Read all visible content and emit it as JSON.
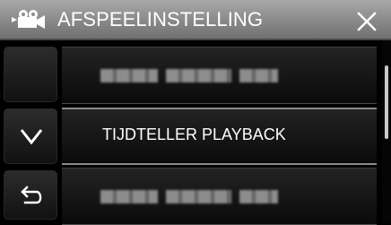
{
  "window": {
    "title": "AFSPEELINSTELLING"
  },
  "title_bar": {
    "camera_icon": "playback-camera-icon",
    "close_icon": "close-x-icon"
  },
  "navigation": {
    "down_icon": "chevron-down-icon",
    "back_icon": "return-arrow-icon"
  },
  "menu": {
    "items": [
      {
        "label": "",
        "state": "blurred-menu-option"
      },
      {
        "label": "TIJDTELLER PLAYBACK",
        "state": "visible-menu-option"
      },
      {
        "label": "",
        "state": "blurred-menu-option"
      }
    ]
  },
  "scrollbar": {
    "visible_fraction": 0.4
  },
  "colors": {
    "background": "#000000",
    "title_bar_top": "#a9a9a9",
    "title_bar_bottom": "#707070",
    "text": "#ffffff",
    "menu_border": "#8c8c8c"
  }
}
